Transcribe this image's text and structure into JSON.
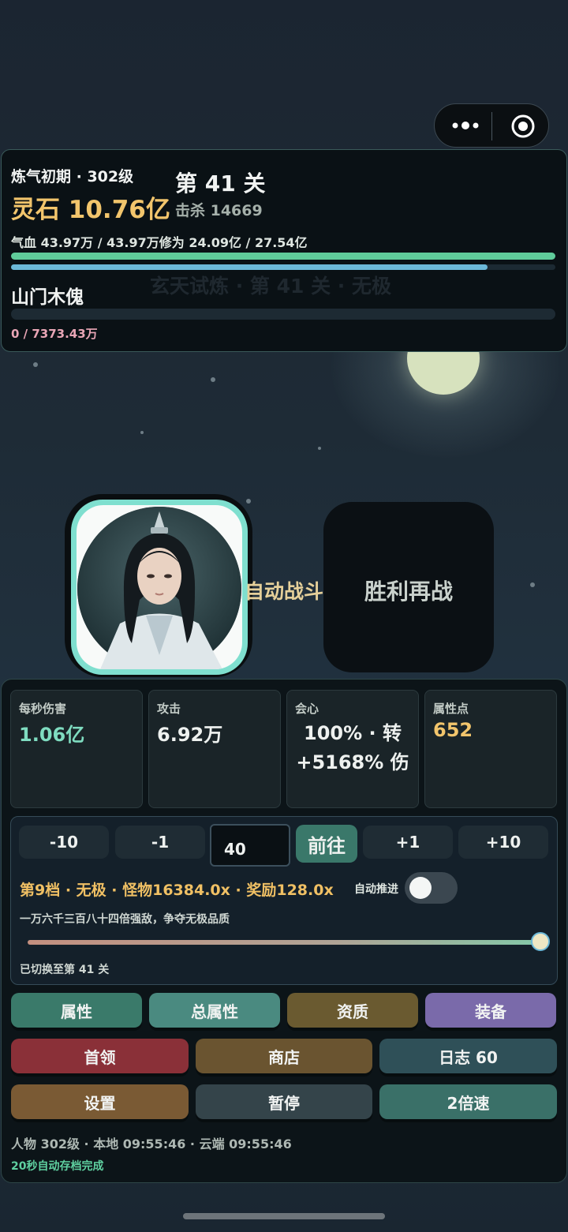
{
  "capsule": {
    "more_icon": "more-dots-icon",
    "close_icon": "target-icon"
  },
  "header": {
    "realm": "炼气初期 · 302级",
    "stage": "第 41 关",
    "spirit_stone": "灵石 10.76亿",
    "kills": "击杀 14669",
    "stats_line": "气血 43.97万 / 43.97万修为 24.09亿 / 27.54亿",
    "hp_fraction": 1.0,
    "xp_fraction": 0.875,
    "enemy_name": "山门木傀",
    "enemy_hp": "0 / 7373.43万",
    "enemy_hp_fraction": 0.0
  },
  "scene": {
    "ghost_title": "玄天试炼 · 第 41 关 · 无极",
    "auto_fight": "自动战斗",
    "win_again": "胜利再战"
  },
  "stats": [
    {
      "label": "每秒伤害",
      "value": "1.06亿",
      "color": "#7fdcc0"
    },
    {
      "label": "攻击",
      "value": "6.92万",
      "color": "#eef1ef"
    },
    {
      "label": "会心",
      "value": "100% · 转+5168% 伤",
      "color": "#eef1ef"
    },
    {
      "label": "属性点",
      "value": "652",
      "color": "#f2c56c"
    }
  ],
  "controls": {
    "minus10": "-10",
    "minus1": "-1",
    "stage_input": "40",
    "go": "前往",
    "plus1": "+1",
    "plus10": "+10",
    "tier_line": "第9档 · 无极 · 怪物16384.0x · 奖励128.0x",
    "auto_push": "自动推进",
    "auto_push_on": false,
    "tier_desc": "一万六千三百八十四倍强敌，争夺无极品质",
    "slider_fraction": 1.0,
    "switched": "已切换至第 41 关"
  },
  "buttons": {
    "row1": [
      {
        "label": "属性",
        "color": "#3a7a6a"
      },
      {
        "label": "总属性",
        "color": "#4a8a80"
      },
      {
        "label": "资质",
        "color": "#6a5a30"
      },
      {
        "label": "装备",
        "color": "#7a6aaa"
      }
    ],
    "row2": [
      {
        "label": "首领",
        "color": "#8a3038"
      },
      {
        "label": "商店",
        "color": "#6a5430"
      },
      {
        "label": "日志 60",
        "color": "#2f5058"
      }
    ],
    "row3": [
      {
        "label": "设置",
        "color": "#7a5a34"
      },
      {
        "label": "暂停",
        "color": "#34444a"
      },
      {
        "label": "2倍速",
        "color": "#3a7068"
      }
    ]
  },
  "footer": {
    "info": "人物 302级 · 本地 09:55:46 · 云端 09:55:46",
    "autosave": "20秒自动存档完成"
  }
}
